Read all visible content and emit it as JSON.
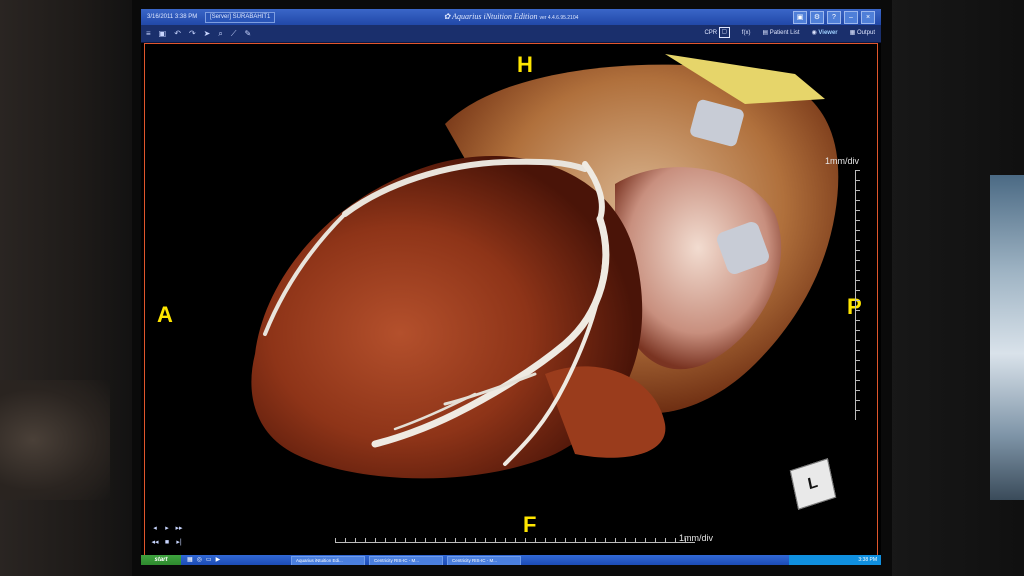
{
  "window": {
    "date": "3/16/2011  3:38 PM",
    "server": "[Server] SURABAHIT1",
    "app_title": "Aquarius iNtuition Edition",
    "version": "ver 4.4.6.95.2104",
    "buttons": [
      "▣",
      "⚙",
      "?",
      "–",
      "×"
    ]
  },
  "toolbar": {
    "icons": [
      "menu-icon",
      "save-icon",
      "undo-icon",
      "redo-icon",
      "pointer-icon",
      "magnify-icon",
      "measure-icon",
      "pen-icon"
    ],
    "cpr_label": "CPR",
    "fd_label": "f(x)",
    "patient_list": "Patient List",
    "viewer": "Viewer",
    "output": "Output"
  },
  "viewport": {
    "orientation": {
      "top": "H",
      "bottom": "F",
      "left": "A",
      "right": "P"
    },
    "scale_vertical": "1mm/div",
    "scale_horizontal": "1mm/div",
    "cube_label": "L"
  },
  "taskbar": {
    "start": "start",
    "items": [
      "Aquarius iNtuition Edi...",
      "Centricity RIS-IC - M...",
      "Centricity RIS-IC - M..."
    ],
    "clock": "3:38 PM"
  }
}
